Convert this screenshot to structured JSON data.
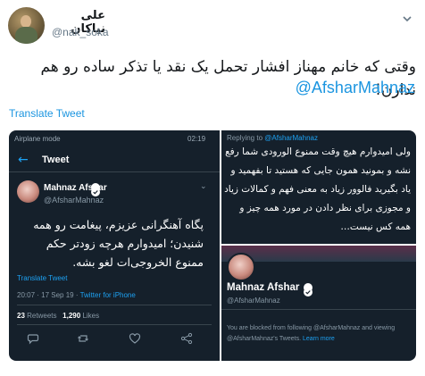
{
  "author": {
    "name": "علی نیاکان",
    "handle": "@nak_soka"
  },
  "tweet": {
    "text": "وقتی که خانم مهناز افشار تحمل یک نقد یا تذکر ساده رو هم ندارن!",
    "mention": "@AfsharMahnaz",
    "translate_label": "Translate Tweet"
  },
  "screenshot_left": {
    "status_left": "Airplane mode",
    "status_right": "02:19",
    "app_title": "Tweet",
    "name": "Mahnaz Afshar",
    "handle": "@AfsharMahnaz",
    "text": "پگاه آهنگرانی عزیزم، پیغامت رو همه شنیدن؛ امیدوارم هرچه زودتر حکم ممنوع الخروجی‌ات لغو بشه.",
    "translate_label": "Translate Tweet",
    "time": "20:07 · 17 Sep 19 ·",
    "client": "Twitter for iPhone",
    "retweets": "23",
    "retweets_label": "Retweets",
    "likes": "1,290",
    "likes_label": "Likes"
  },
  "screenshot_right_top": {
    "replying_to_label": "Replying to",
    "replying_to_handle": "@AfsharMahnaz",
    "text": "ولی امیدوارم هیچ وقت ممنوع الورودی شما رفع نشه و بمونید همون جایی که هستید تا بفهمید و یاد بگیرید فالوور زیاد به معنی فهم و کمالات زیاد و مجوزی برای نظر دادن در مورد همه چیز و همه کس نیست…"
  },
  "screenshot_right_bottom": {
    "name": "Mahnaz Afshar",
    "handle": "@AfsharMahnaz",
    "blocked_text": "You are blocked from following @AfsharMahnaz and viewing @AfsharMahnaz's Tweets.",
    "learn_more": "Learn more"
  },
  "colors": {
    "link": "#1b95e0",
    "dark_bg": "#15202b"
  }
}
